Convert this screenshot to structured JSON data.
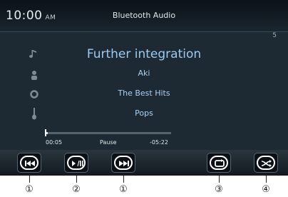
{
  "status_bar": {
    "time": "10:00",
    "ampm": "AM",
    "source_title": "Bluetooth Audio"
  },
  "track_number": "5",
  "track": {
    "title": "Further integration",
    "artist": "Aki",
    "album": "The Best Hits",
    "genre": "Pops"
  },
  "icons": {
    "title": "music-note-icon",
    "artist": "person-icon",
    "album": "disc-icon",
    "genre": "guitar-icon"
  },
  "playback": {
    "elapsed": "00:05",
    "status": "Pause",
    "remaining": "-05:22",
    "progress_fraction": 0.015
  },
  "controls": [
    {
      "name": "previous-track-button",
      "icon": "previous-track-icon",
      "callout": "①"
    },
    {
      "name": "play-pause-button",
      "icon": "play-pause-icon",
      "callout": "②"
    },
    {
      "name": "next-track-button",
      "icon": "next-track-icon",
      "callout": "①"
    },
    {
      "name": "repeat-button",
      "icon": "repeat-icon",
      "callout": "③"
    },
    {
      "name": "shuffle-button",
      "icon": "shuffle-icon",
      "callout": "④"
    }
  ],
  "colors": {
    "background": "#1e2a33",
    "accent_text": "#9ecaf0",
    "button_bg": "#0a1015"
  }
}
